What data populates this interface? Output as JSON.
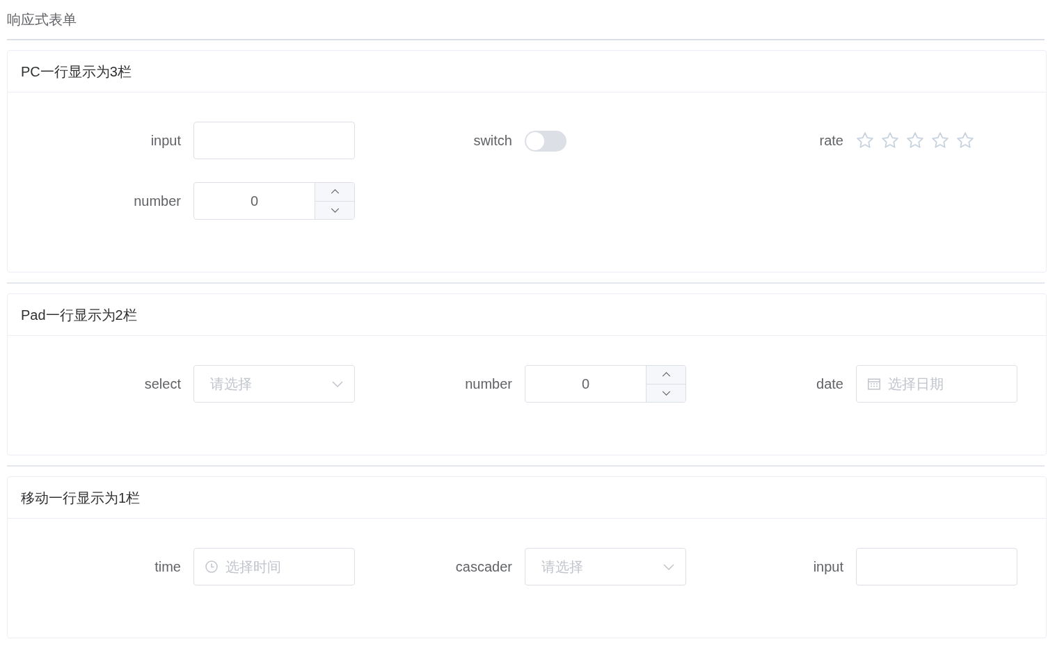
{
  "page": {
    "title": "响应式表单"
  },
  "sections": [
    {
      "title": "PC一行显示为3栏",
      "items": [
        {
          "kind": "input",
          "label": "input"
        },
        {
          "kind": "switch",
          "label": "switch",
          "on": false
        },
        {
          "kind": "rate",
          "label": "rate",
          "stars": 0
        },
        {
          "kind": "number",
          "label": "number",
          "value": "0"
        }
      ]
    },
    {
      "title": "Pad一行显示为2栏",
      "items": [
        {
          "kind": "select",
          "label": "select",
          "placeholder": "请选择"
        },
        {
          "kind": "number",
          "label": "number",
          "value": "0"
        },
        {
          "kind": "date",
          "label": "date",
          "placeholder": "选择日期"
        }
      ]
    },
    {
      "title": "移动一行显示为1栏",
      "items": [
        {
          "kind": "time",
          "label": "time",
          "placeholder": "选择时间"
        },
        {
          "kind": "cascader",
          "label": "cascader",
          "placeholder": "请选择"
        },
        {
          "kind": "input",
          "label": "input"
        }
      ]
    }
  ]
}
